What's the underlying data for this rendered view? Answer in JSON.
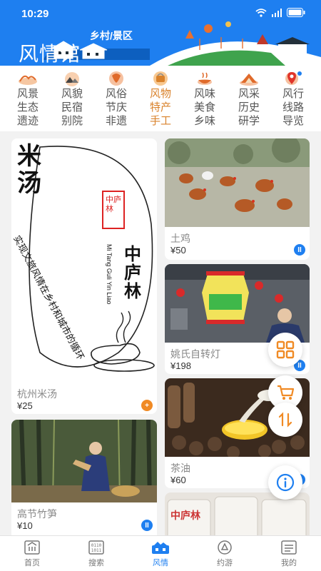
{
  "status_bar": {
    "time": "10:29"
  },
  "header": {
    "title": "风情馆",
    "subtitle": "乡村/景区",
    "background_color": "#1e7ff0"
  },
  "categories": [
    {
      "lines": [
        "风景",
        "生态",
        "遗迹"
      ],
      "icon": "landscape-icon",
      "active": false
    },
    {
      "lines": [
        "风貌",
        "民宿",
        "别院"
      ],
      "icon": "homestay-icon",
      "active": false
    },
    {
      "lines": [
        "风俗",
        "节庆",
        "非遗"
      ],
      "icon": "festival-icon",
      "active": false
    },
    {
      "lines": [
        "风物",
        "特产",
        "手工"
      ],
      "icon": "specialty-icon",
      "active": true
    },
    {
      "lines": [
        "风味",
        "美食",
        "乡味"
      ],
      "icon": "food-icon",
      "active": false
    },
    {
      "lines": [
        "风采",
        "历史",
        "研学"
      ],
      "icon": "history-icon",
      "active": false
    },
    {
      "lines": [
        "风行",
        "线路",
        "导览"
      ],
      "icon": "route-icon",
      "active": false
    }
  ],
  "products": {
    "mitang": {
      "poster_big": "米汤",
      "poster_slogan": "实现文旅风情在乡村和城市的循环",
      "poster_brand": "中庐林",
      "poster_brand_en": "Mi Tang Guli Yin Liao",
      "poster_seal": "中庐林",
      "title": "杭州米汤",
      "price": "¥25",
      "badge_color": "#f08a24"
    },
    "chicken": {
      "title": "土鸡",
      "price": "¥50",
      "badge_color": "#1e7ff0"
    },
    "lantern": {
      "title": "姚氏自转灯",
      "price": "¥198",
      "badge_color": "#1e7ff0"
    },
    "oil": {
      "title": "茶油",
      "price": "¥60",
      "badge_color": "#1e7ff0"
    },
    "bamboo": {
      "title": "高节竹笋",
      "price": "¥10",
      "badge_color": "#1e7ff0"
    },
    "extra": {
      "label": "中庐林"
    }
  },
  "tabs": [
    {
      "label": "首页",
      "icon": "home-icon",
      "active": false
    },
    {
      "label": "搜索",
      "icon": "search-icon",
      "active": false
    },
    {
      "label": "风情",
      "icon": "fengqing-icon",
      "active": true
    },
    {
      "label": "约游",
      "icon": "travel-icon",
      "active": false
    },
    {
      "label": "我的",
      "icon": "profile-icon",
      "active": false
    }
  ],
  "colors": {
    "accent": "#1e7ff0",
    "orange": "#f08a24",
    "active_category": "#d9822b"
  }
}
